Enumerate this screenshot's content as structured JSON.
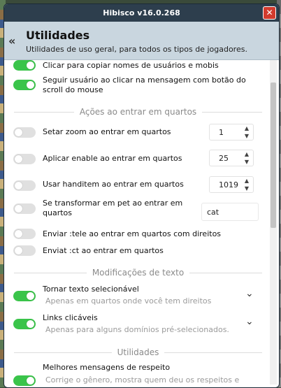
{
  "window": {
    "title": "Hibisco v16.0.268",
    "close_icon": "close-icon"
  },
  "header": {
    "title": "Utilidades",
    "subtitle": "Utilidades de uso geral, para todos os tipos de jogadores.",
    "back_icon": "double-chevron-left-icon"
  },
  "top_items": [
    {
      "label": "Clicar para copiar nomes de usuários e mobis",
      "enabled": true
    },
    {
      "label_line1": "Seguir usuário ao clicar na mensagem com botão do",
      "label_line2": "scroll do mouse",
      "enabled": true
    }
  ],
  "section_rooms": {
    "title": "Ações ao entrar em quartos",
    "items": [
      {
        "label": "Setar zoom ao entrar em quartos",
        "enabled": false,
        "value": "1"
      },
      {
        "label": "Aplicar enable ao entrar em quartos",
        "enabled": false,
        "value": "25"
      },
      {
        "label": "Usar handitem ao entrar em quartos",
        "enabled": false,
        "value": "1019"
      },
      {
        "label_line1": "Se transformar em pet ao entrar em",
        "label_line2": "quartos",
        "enabled": false,
        "value": "cat"
      },
      {
        "label": "Enviar :tele ao entrar em quartos com direitos",
        "enabled": false
      },
      {
        "label": "Enviat :ct ao entrar em quartos",
        "enabled": false
      }
    ]
  },
  "section_text": {
    "title": "Modificações de texto",
    "items": [
      {
        "label": "Tornar texto selecionável",
        "description": "Apenas em quartos onde você tem direitos",
        "enabled": true
      },
      {
        "label": "Links clicáveis",
        "description": "Apenas para alguns domínios pré-selecionados.",
        "enabled": true
      }
    ]
  },
  "section_utils": {
    "title": "Utilidades",
    "items": [
      {
        "label": "Melhores mensagens de respeito",
        "description": "Corrige o gênero, mostra quem deu os respeitos e",
        "enabled": true
      }
    ]
  },
  "colors": {
    "toggle_on": "#3ac44a",
    "toggle_off": "#e0e0e0",
    "titlebar": "#2d3e4d",
    "header": "#c9d6df",
    "close": "#d23b2e"
  }
}
